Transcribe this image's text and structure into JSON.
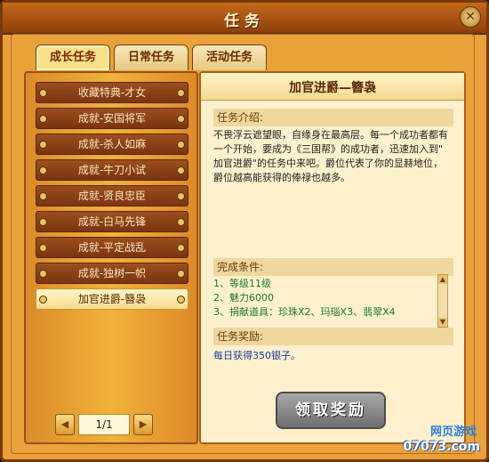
{
  "window": {
    "title": "任务",
    "close_icon": "close-icon"
  },
  "tabs": [
    {
      "label": "成长任务",
      "active": true
    },
    {
      "label": "日常任务",
      "active": false
    },
    {
      "label": "活动任务",
      "active": false
    }
  ],
  "quest_list": [
    {
      "label": "收藏特典-才女"
    },
    {
      "label": "成就-安国将军"
    },
    {
      "label": "成就-杀人如麻"
    },
    {
      "label": "成就-牛刀小试"
    },
    {
      "label": "成就-贤良忠臣"
    },
    {
      "label": "成就-白马先锋"
    },
    {
      "label": "成就-平定战乱"
    },
    {
      "label": "成就-独树一帜"
    },
    {
      "label": "加官进爵-簪袅",
      "selected": true
    }
  ],
  "pager": {
    "prev_icon": "chevron-left-icon",
    "next_icon": "chevron-right-icon",
    "page_text": "1/1"
  },
  "detail": {
    "title": "加官进爵—簪袅",
    "intro_header": "任务介绍:",
    "intro_lines": [
      "不畏浮云遮望眼，自缘身在最高层。每一个成功者都有",
      "一个开始，要成为《三国帮》的成功者，迅速加入到\"",
      "加官进爵\"的任务中来吧。爵位代表了你的显赫地位，",
      "爵位越高能获得的俸禄也越多。"
    ],
    "conditions_header": "完成条件:",
    "conditions": [
      "1、等级11级",
      "2、魅力6000",
      "3、捐献道具：珍珠X2、玛瑙X3、翡翠X4"
    ],
    "reward_header": "任务奖励:",
    "reward_text": "每日获得350银子。",
    "claim_button": "领取奖励"
  },
  "watermark": {
    "line1": "网页游戏",
    "line2": "07073.com"
  }
}
